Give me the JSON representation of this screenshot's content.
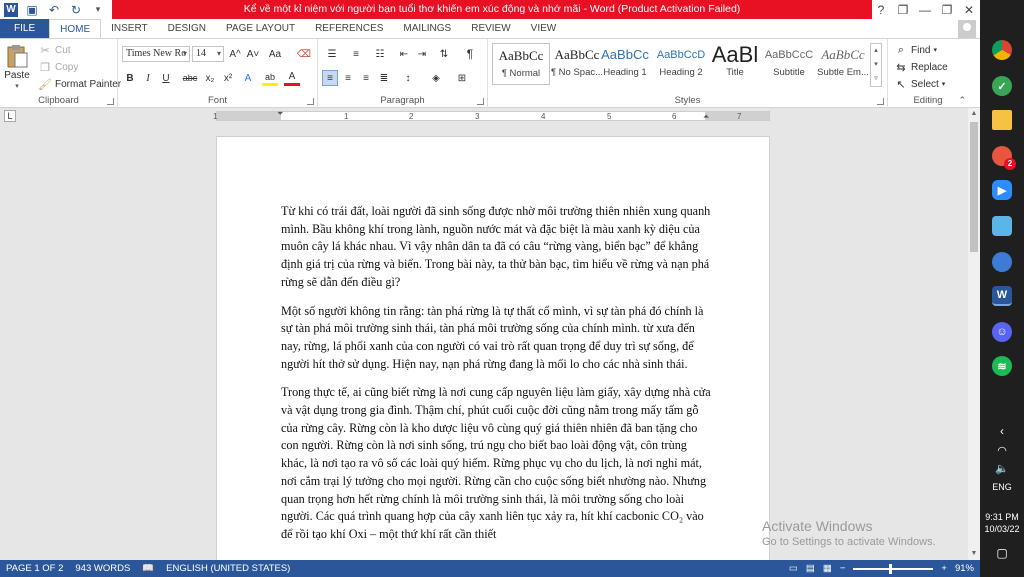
{
  "window": {
    "title": "Kể về một kỉ niệm với người bạn tuổi thơ khiến em xúc động và nhớ mãi - Word (Product Activation Failed)",
    "controls": [
      "?",
      "❐",
      "—",
      "❐",
      "✕"
    ]
  },
  "tabs": [
    {
      "label": "FILE"
    },
    {
      "label": "HOME"
    },
    {
      "label": "INSERT"
    },
    {
      "label": "DESIGN"
    },
    {
      "label": "PAGE LAYOUT"
    },
    {
      "label": "REFERENCES"
    },
    {
      "label": "MAILINGS"
    },
    {
      "label": "REVIEW"
    },
    {
      "label": "VIEW"
    }
  ],
  "ribbon": {
    "clipboard": {
      "label": "Clipboard",
      "paste": "Paste",
      "cut": "Cut",
      "copy": "Copy",
      "format_painter": "Format Painter"
    },
    "font": {
      "label": "Font",
      "family": "Times New Ro",
      "size": "14",
      "bold": "B",
      "italic": "I",
      "underline": "U",
      "strike": "abc",
      "subscript": "x₂",
      "superscript": "x²",
      "grow": "A^",
      "shrink": "A˅",
      "case": "Aa",
      "text_effects": "A",
      "highlight": "ab",
      "font_color": "A"
    },
    "paragraph": {
      "label": "Paragraph",
      "show_marks": "¶"
    },
    "styles": {
      "label": "Styles",
      "items": [
        {
          "sample": "AaBbCc",
          "name": "¶ Normal"
        },
        {
          "sample": "AaBbCc",
          "name": "¶ No Spac..."
        },
        {
          "sample": "AaBbCc",
          "name": "Heading 1"
        },
        {
          "sample": "AaBbCcD",
          "name": "Heading 2"
        },
        {
          "sample": "AaBl",
          "name": "Title"
        },
        {
          "sample": "AaBbCcC",
          "name": "Subtitle"
        },
        {
          "sample": "AaBbCc",
          "name": "Subtle Em..."
        }
      ]
    },
    "editing": {
      "label": "Editing",
      "find": "Find",
      "replace": "Replace",
      "select": "Select"
    }
  },
  "ruler": {
    "numbers": [
      "1",
      "1",
      "2",
      "3",
      "4",
      "5",
      "6",
      "7"
    ],
    "tab_selector": "L"
  },
  "document": {
    "paragraphs": [
      "Từ khi có trái đất, loài người đã sinh sống được nhờ môi trường thiên nhiên xung quanh mình. Bầu không khí trong lành, nguồn nước mát và đặc biệt là màu xanh kỳ diệu của muôn cây lá khác nhau. Vì vậy nhân dân ta đã có câu “rừng vàng, biển bạc” để khẳng định giá trị của rừng và biển. Trong bài này, ta thử bàn bạc, tìm hiểu về rừng và nạn phá rừng sẽ dẫn đến điều gì?",
      "Một số người không tin rằng: tàn phá rừng là tự thất cổ mình, vì sự tàn phá đó chính là sự tàn phá môi trường sinh thái, tàn phá môi trường sống của chính mình. từ xưa đến nay, rừng, lá phổi xanh của con người có vai trò rất quan trọng để duy trì sự sống, để người hít thở sử dụng. Hiện nay, nạn phá rừng đang là mối lo cho các nhà sinh thái.",
      "Trong thực tế, ai cũng biết rừng là nơi cung cấp nguyên liệu làm giấy, xây dựng nhà cửa và vật dụng trong gia đình. Thậm chí, phút cuối cuộc đời cũng nằm trong mấy tấm gỗ của rừng cây. Rừng còn là kho dược liệu vô cùng quý giá thiên nhiên đã ban tặng cho con người. Rừng còn là nơi sinh sống, trú ngụ cho biết bao loài động vật, côn trùng khác, là nơi tạo ra vô số các loài quý hiếm. Rừng phục vụ cho du lịch, là nơi nghỉ mát, nơi cắm trại lý tưởng cho mọi người. Rừng cần cho cuộc sống biết nhường nào. Nhưng quan trọng hơn hết rừng chính là môi trường sinh thái, là môi trường sống cho loài người. Các quá trình quang hợp của cây xanh liên tục xảy ra, hít khí cacbonic CO₂ vào để rồi tạo khí Oxi – một thứ khí rất cần thiết"
    ]
  },
  "watermark": {
    "line1": "Activate Windows",
    "line2": "Go to Settings to activate Windows."
  },
  "status": {
    "page": "PAGE 1 OF 2",
    "words": "943 WORDS",
    "language": "ENGLISH (UNITED STATES)",
    "zoom": "91%",
    "zoom_level": 0.45
  },
  "taskbar": {
    "badge": "2",
    "lang": "ENG",
    "time": "9:31 PM",
    "date": "10/03/22"
  },
  "colors": {
    "accent": "#2b579a",
    "alert": "#e81123",
    "taskbar": "#1f1f1f"
  }
}
